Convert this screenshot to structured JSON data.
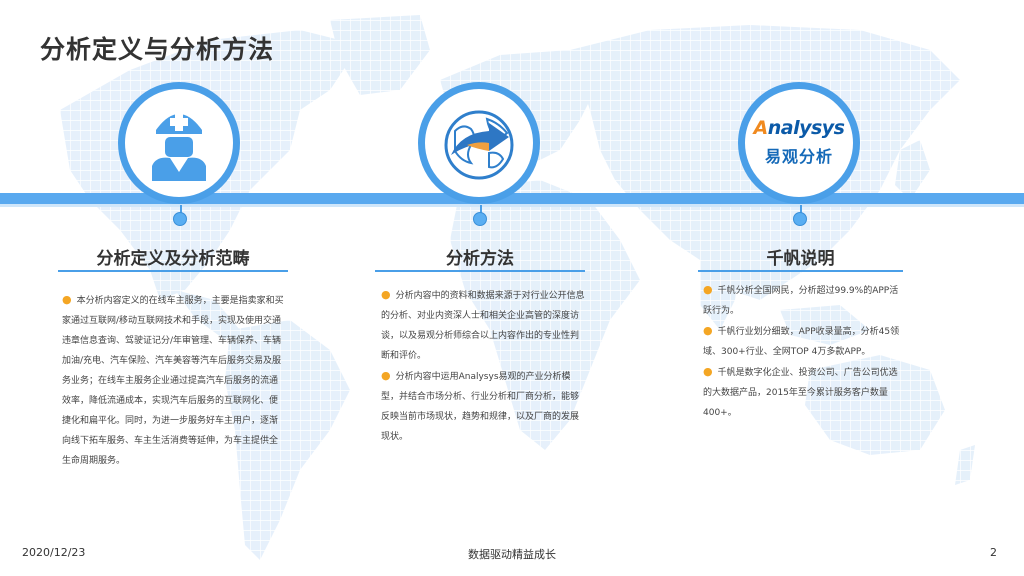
{
  "page": {
    "title": "分析定义与分析方法"
  },
  "icons": {
    "col1": "nurse-icon",
    "col2": "globe-arrow-icon",
    "col3": "analysys-logo"
  },
  "logo": {
    "brand_prefix": "A",
    "brand_rest": "nalysys",
    "brand_cn": "易观分析"
  },
  "columns": [
    {
      "heading": "分析定义及分析范畴",
      "paragraphs": [
        "本分析内容定义的在线车主服务，主要是指卖家和买家通过互联网/移动互联网技术和手段，实现及使用交通违章信息查询、驾驶证记分/年审管理、车辆保养、车辆加油/充电、汽车保险、汽车美容等汽车后服务交易及服务业务；在线车主服务企业通过提高汽车后服务的流通效率，降低流通成本，实现汽车后服务的互联网化、便捷化和扁平化。同时，为进一步服务好车主用户，逐渐向线下拓车服务、车主生活消费等延伸，为车主提供全生命周期服务。"
      ]
    },
    {
      "heading": "分析方法",
      "paragraphs": [
        "分析内容中的资料和数据来源于对行业公开信息的分析、对业内资深人士和相关企业高管的深度访谈，以及易观分析师综合以上内容作出的专业性判断和评价。",
        "分析内容中运用Analysys易观的产业分析模型，并结合市场分析、行业分析和厂商分析，能够反映当前市场现状，趋势和规律，以及厂商的发展现状。"
      ]
    },
    {
      "heading": "千帆说明",
      "paragraphs": [
        "千帆分析全国网民，分析超过99.9%的APP活跃行为。",
        "千帆行业划分细致，APP收录量高，分析45领域、300+行业、全网TOP 4万多款APP。",
        "千帆是数字化企业、投资公司、广告公司优选的大数据产品，2015年至今累计服务客户数量400+。"
      ]
    }
  ],
  "footer": {
    "date": "2020/12/23",
    "slogan": "数据驱动精益成长",
    "page_number": "2"
  },
  "colors": {
    "accent_blue": "#4A9FE8",
    "bullet_orange": "#F4A624",
    "map_tint": "#E9F3FC"
  }
}
